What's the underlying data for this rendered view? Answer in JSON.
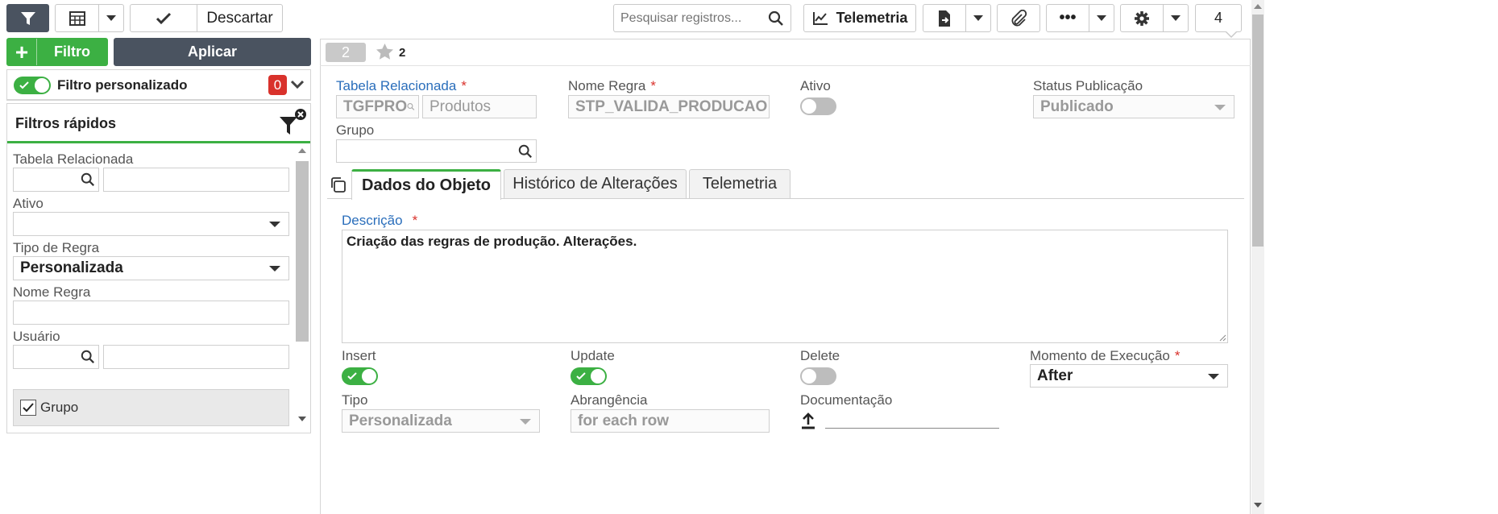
{
  "toolbar": {
    "discard_label": "Descartar",
    "search_placeholder": "Pesquisar registros...",
    "telemetry_label": "Telemetria",
    "record_count": "4"
  },
  "sidebar": {
    "add_filter_label": "Filtro",
    "apply_label": "Aplicar",
    "custom_filter_label": "Filtro personalizado",
    "custom_filter_count": "0",
    "quick_filters_title": "Filtros rápidos",
    "fields": {
      "related_table_label": "Tabela Relacionada",
      "active_label": "Ativo",
      "rule_type_label": "Tipo de Regra",
      "rule_type_value": "Personalizada",
      "rule_name_label": "Nome Regra",
      "user_label": "Usuário",
      "group_checkbox_label": "Grupo"
    }
  },
  "record": {
    "index": "2",
    "favorites_count": "2",
    "related_table_label": "Tabela Relacionada",
    "related_table_code": "TGFPRO",
    "related_table_name": "Produtos",
    "rule_name_label": "Nome Regra",
    "rule_name_value": "STP_VALIDA_PRODUCAO",
    "active_label": "Ativo",
    "publish_status_label": "Status Publicação",
    "publish_status_value": "Publicado",
    "group_label": "Grupo",
    "required_mark": "*"
  },
  "tabs": [
    {
      "label": "Dados do Objeto"
    },
    {
      "label": "Histórico de Alterações"
    },
    {
      "label": "Telemetria"
    }
  ],
  "object_data": {
    "description_label": "Descrição",
    "description_value": "Criação das regras de produção. Alterações.",
    "insert_label": "Insert",
    "update_label": "Update",
    "delete_label": "Delete",
    "execution_moment_label": "Momento de Execução",
    "execution_moment_value": "After",
    "type_label": "Tipo",
    "type_value": "Personalizada",
    "scope_label": "Abrangência",
    "scope_value": "for each row",
    "documentation_label": "Documentação"
  },
  "colors": {
    "accent_green": "#3cb043",
    "dark_button": "#4a5360",
    "link_blue": "#2a6ebb",
    "required_red": "#d9322c"
  }
}
